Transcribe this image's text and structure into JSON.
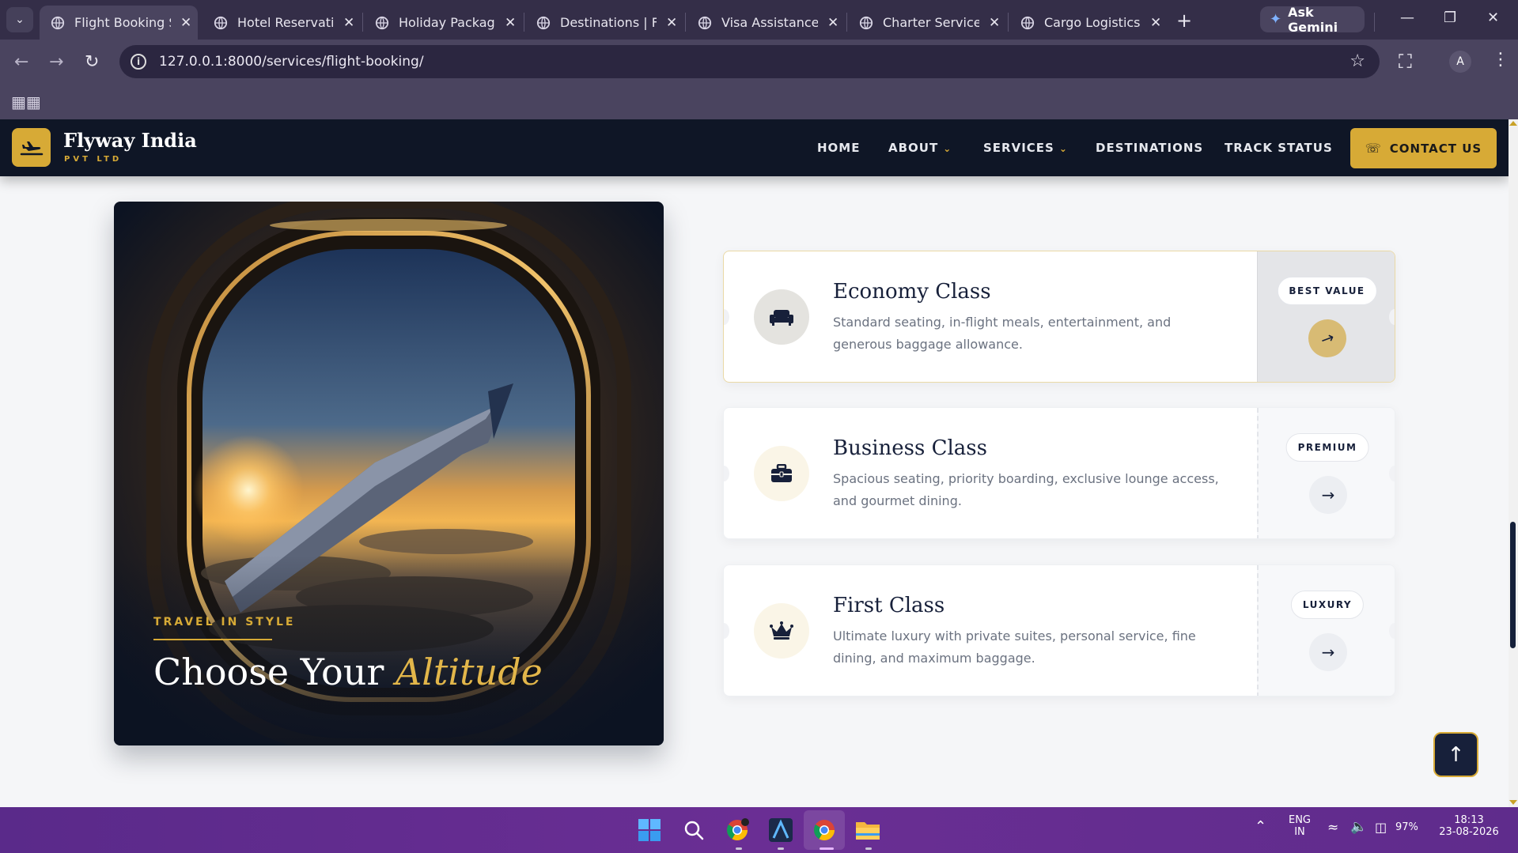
{
  "browser": {
    "tabs": [
      {
        "title": "Flight Booking Se",
        "active": true
      },
      {
        "title": "Hotel Reservation",
        "active": false
      },
      {
        "title": "Holiday Packages",
        "active": false
      },
      {
        "title": "Destinations | Flyw",
        "active": false
      },
      {
        "title": "Visa Assistance Se",
        "active": false
      },
      {
        "title": "Charter Services |",
        "active": false
      },
      {
        "title": "Cargo Logistics S",
        "active": false
      }
    ],
    "gemini_label": "Ask Gemini",
    "url": "127.0.0.1:8000/services/flight-booking/",
    "profile_initial": "A"
  },
  "site": {
    "brand_name": "Flyway India",
    "brand_sub": "PVT LTD",
    "nav": {
      "home": "HOME",
      "about": "ABOUT",
      "services": "SERVICES",
      "destinations": "DESTINATIONS",
      "track": "TRACK STATUS"
    },
    "contact_label": "CONTACT US",
    "accent": "#d7aa36",
    "navy": "#0f1626"
  },
  "hero": {
    "eyebrow": "TRAVEL IN STYLE",
    "title_plain": "Choose Your",
    "title_accent": "Altitude"
  },
  "classes": [
    {
      "title": "Economy Class",
      "desc": "Standard seating, in-flight meals, entertainment, and generous baggage allowance.",
      "badge": "BEST VALUE",
      "icon": "sofa-icon"
    },
    {
      "title": "Business Class",
      "desc": "Spacious seating, priority boarding, exclusive lounge access, and gourmet dining.",
      "badge": "PREMIUM",
      "icon": "briefcase-icon"
    },
    {
      "title": "First Class",
      "desc": "Ultimate luxury with private suites, personal service, fine dining, and maximum baggage.",
      "badge": "LUXURY",
      "icon": "crown-icon"
    }
  ],
  "taskbar": {
    "lang_top": "ENG",
    "lang_bottom": "IN",
    "battery": "97%",
    "time": "18:13",
    "date": "23-08-2026"
  }
}
